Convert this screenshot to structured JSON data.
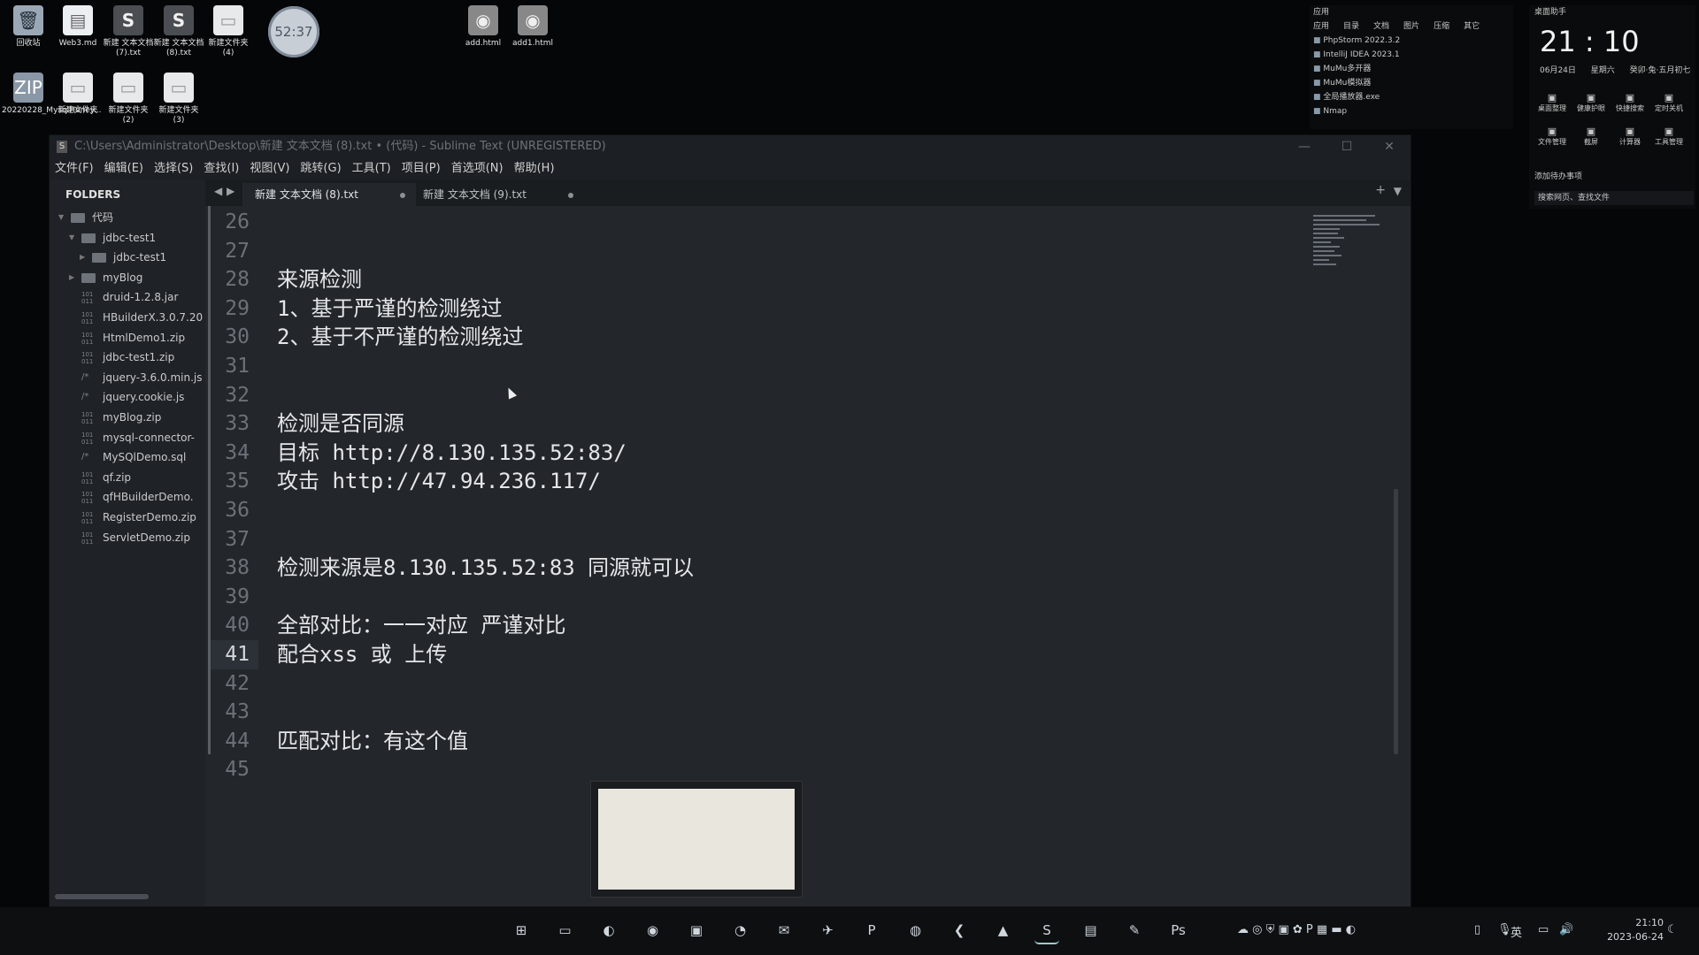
{
  "desktop": {
    "icons": [
      {
        "label": "回收站",
        "glyph": "🗑",
        "kind": "bin"
      },
      {
        "label": "Web3.md",
        "glyph": "▤",
        "kind": "doc"
      },
      {
        "label": "新建 文本文档 (7).txt",
        "glyph": "S",
        "kind": "subl"
      },
      {
        "label": "新建 文本文档 (8).txt",
        "glyph": "S",
        "kind": "subl"
      },
      {
        "label": "新建文件夹 (4)",
        "glyph": "▭",
        "kind": "folder"
      },
      {
        "label": "add.html",
        "glyph": "◉",
        "kind": "chrome"
      },
      {
        "label": "add1.html",
        "glyph": "◉",
        "kind": "chrome"
      },
      {
        "label": "20220228_MysqlHoney...",
        "glyph": "ZIP",
        "kind": "zip"
      },
      {
        "label": "新建文件夹",
        "glyph": "▭",
        "kind": "folder"
      },
      {
        "label": "新建文件夹 (2)",
        "glyph": "▭",
        "kind": "folder"
      },
      {
        "label": "新建文件夹 (3)",
        "glyph": "▭",
        "kind": "folder"
      }
    ],
    "timer": "52:37"
  },
  "apps_panel": {
    "title": "应用",
    "tabs": [
      "应用",
      "目录",
      "文档",
      "图片",
      "压缩",
      "其它"
    ],
    "items": [
      "PhpStorm 2022.3.2",
      "IntelliJ IDEA 2023.1",
      "MuMu多开器",
      "MuMu模拟器",
      "全局播放器.exe",
      "Nmap"
    ]
  },
  "clock_panel": {
    "title": "桌面助手",
    "time": "21 : 10",
    "date": "06月24日",
    "weekday": "星期六",
    "lunar": "癸卯·兔·五月初七",
    "actions_row1": [
      "桌面整理",
      "健康护眼",
      "快捷搜索",
      "定时关机"
    ],
    "actions_row2": [
      "文件管理",
      "截屏",
      "计算器",
      "工具管理"
    ],
    "todo": "添加待办事项",
    "search": "搜索网页、查找文件"
  },
  "window": {
    "title": "C:\\Users\\Administrator\\Desktop\\新建 文本文档 (8).txt • (代码) - Sublime Text (UNREGISTERED)",
    "controls": {
      "min": "—",
      "max": "☐",
      "close": "✕"
    },
    "menu": [
      "文件(F)",
      "编辑(E)",
      "选择(S)",
      "查找(I)",
      "视图(V)",
      "跳转(G)",
      "工具(T)",
      "项目(P)",
      "首选项(N)",
      "帮助(H)"
    ],
    "sidebar": {
      "header": "FOLDERS",
      "items": [
        {
          "label": "代码",
          "type": "folder-open",
          "indent": 0
        },
        {
          "label": "jdbc-test1",
          "type": "folder-open",
          "indent": 1
        },
        {
          "label": "jdbc-test1",
          "type": "folder",
          "indent": 2
        },
        {
          "label": "myBlog",
          "type": "folder",
          "indent": 1
        },
        {
          "label": "druid-1.2.8.jar",
          "type": "binary",
          "indent": 1
        },
        {
          "label": "HBuilderX.3.0.7.20",
          "type": "binary",
          "indent": 1
        },
        {
          "label": "HtmlDemo1.zip",
          "type": "binary",
          "indent": 1
        },
        {
          "label": "jdbc-test1.zip",
          "type": "binary",
          "indent": 1
        },
        {
          "label": "jquery-3.6.0.min.js",
          "type": "script",
          "indent": 1
        },
        {
          "label": "jquery.cookie.js",
          "type": "script",
          "indent": 1
        },
        {
          "label": "myBlog.zip",
          "type": "binary",
          "indent": 1
        },
        {
          "label": "mysql-connector-",
          "type": "binary",
          "indent": 1
        },
        {
          "label": "MySQlDemo.sql",
          "type": "script",
          "indent": 1
        },
        {
          "label": "qf.zip",
          "type": "binary",
          "indent": 1
        },
        {
          "label": "qfHBuilderDemo.",
          "type": "binary",
          "indent": 1
        },
        {
          "label": "RegisterDemo.zip",
          "type": "binary",
          "indent": 1
        },
        {
          "label": "ServletDemo.zip",
          "type": "binary",
          "indent": 1
        }
      ]
    },
    "tabs": [
      {
        "label": "新建 文本文档 (8).txt",
        "active": true
      },
      {
        "label": "新建 文本文档 (9).txt",
        "active": false
      }
    ],
    "current_line": "41",
    "lines": [
      {
        "n": "26",
        "text": ""
      },
      {
        "n": "27",
        "text": ""
      },
      {
        "n": "28",
        "text": "来源检测"
      },
      {
        "n": "29",
        "text": "1、基于严谨的检测绕过"
      },
      {
        "n": "30",
        "text": "2、基于不严谨的检测绕过"
      },
      {
        "n": "31",
        "text": ""
      },
      {
        "n": "32",
        "text": ""
      },
      {
        "n": "33",
        "text": "检测是否同源"
      },
      {
        "n": "34",
        "text": "目标 http://8.130.135.52:83/"
      },
      {
        "n": "35",
        "text": "攻击 http://47.94.236.117/"
      },
      {
        "n": "36",
        "text": ""
      },
      {
        "n": "37",
        "text": ""
      },
      {
        "n": "38",
        "text": "检测来源是8.130.135.52:83 同源就可以"
      },
      {
        "n": "39",
        "text": ""
      },
      {
        "n": "40",
        "text": "全部对比：一一对应 严谨对比"
      },
      {
        "n": "41",
        "text": "配合xss 或 上传"
      },
      {
        "n": "42",
        "text": ""
      },
      {
        "n": "43",
        "text": ""
      },
      {
        "n": "44",
        "text": "匹配对比：有这个值"
      },
      {
        "n": "45",
        "text": ""
      }
    ]
  },
  "taskbar": {
    "apps": [
      "start",
      "explorer",
      "edge",
      "chrome",
      "store",
      "steam",
      "mail",
      "network",
      "phpstorm",
      "browser",
      "vscode",
      "monitor",
      "sublime",
      "notes",
      "mail2",
      "ps"
    ],
    "tray_lang": "英",
    "time": "21:10",
    "date": "2023-06-24"
  }
}
